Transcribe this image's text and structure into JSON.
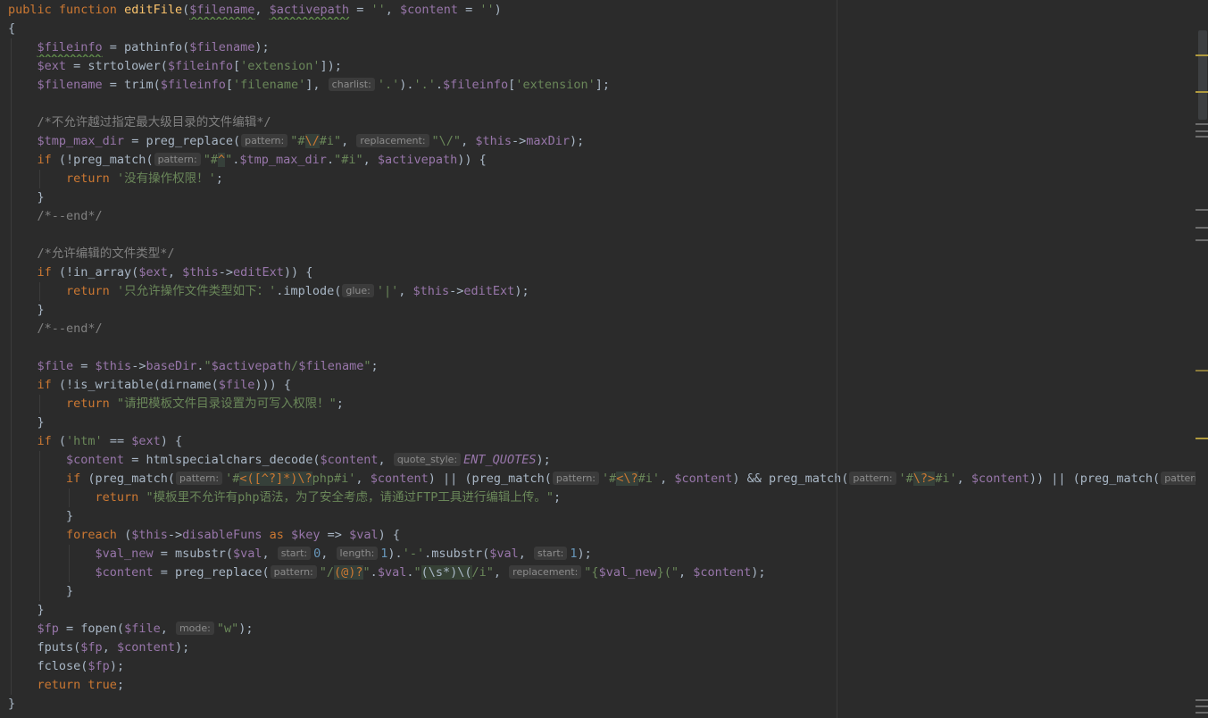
{
  "editor": {
    "language": "php",
    "line_height": 21,
    "char_width": 8.1,
    "lines": [
      {
        "indent": 0,
        "tokens": [
          [
            "kw",
            "public "
          ],
          [
            "kw",
            "function "
          ],
          [
            "fn",
            "editFile"
          ],
          [
            "txt",
            "("
          ],
          [
            "var",
            "$filename"
          ],
          [
            "txt",
            ", "
          ],
          [
            "var",
            "$activepath"
          ],
          [
            "txt",
            " = "
          ],
          [
            "str",
            "''"
          ],
          [
            "txt",
            ", "
          ],
          [
            "var",
            "$content"
          ],
          [
            "txt",
            " = "
          ],
          [
            "str",
            "''"
          ],
          [
            "txt",
            ")"
          ]
        ]
      },
      {
        "indent": 0,
        "tokens": [
          [
            "txt",
            "{"
          ]
        ]
      },
      {
        "indent": 1,
        "tokens": [
          [
            "var",
            "$fileinfo"
          ],
          [
            "txt",
            " = pathinfo("
          ],
          [
            "var",
            "$filename"
          ],
          [
            "txt",
            ");"
          ]
        ]
      },
      {
        "indent": 1,
        "tokens": [
          [
            "var",
            "$ext"
          ],
          [
            "txt",
            " = strtolower("
          ],
          [
            "var",
            "$fileinfo"
          ],
          [
            "txt",
            "["
          ],
          [
            "str",
            "'extension'"
          ],
          [
            "txt",
            "]);"
          ]
        ]
      },
      {
        "indent": 1,
        "tokens": [
          [
            "var",
            "$filename"
          ],
          [
            "txt",
            " = trim("
          ],
          [
            "var",
            "$fileinfo"
          ],
          [
            "txt",
            "["
          ],
          [
            "str",
            "'filename'"
          ],
          [
            "txt",
            "], "
          ],
          [
            "hint",
            "charlist:"
          ],
          [
            "str",
            "'.'"
          ],
          [
            "txt",
            ")."
          ],
          [
            "str",
            "'.'"
          ],
          [
            "txt",
            "."
          ],
          [
            "var",
            "$fileinfo"
          ],
          [
            "txt",
            "["
          ],
          [
            "str",
            "'extension'"
          ],
          [
            "txt",
            "];"
          ]
        ]
      },
      {
        "indent": 0,
        "tokens": []
      },
      {
        "indent": 1,
        "tokens": [
          [
            "cmt",
            "/*不允许越过指定最大级目录的文件编辑*/"
          ]
        ]
      },
      {
        "indent": 1,
        "tokens": [
          [
            "var",
            "$tmp_max_dir"
          ],
          [
            "txt",
            " = preg_replace("
          ],
          [
            "hint",
            "pattern:"
          ],
          [
            "str",
            "\"#"
          ],
          [
            "rx",
            "\\/"
          ],
          [
            "str",
            "#i\""
          ],
          [
            "txt",
            ", "
          ],
          [
            "hint",
            "replacement:"
          ],
          [
            "str",
            "\"\\/\""
          ],
          [
            "txt",
            ", "
          ],
          [
            "var",
            "$this"
          ],
          [
            "txt",
            "->"
          ],
          [
            "prop",
            "maxDir"
          ],
          [
            "txt",
            ");"
          ]
        ]
      },
      {
        "indent": 1,
        "tokens": [
          [
            "kw",
            "if "
          ],
          [
            "txt",
            "(!preg_match("
          ],
          [
            "hint",
            "pattern:"
          ],
          [
            "str",
            "\"#"
          ],
          [
            "rx",
            "^"
          ],
          [
            "str",
            "\""
          ],
          [
            "txt",
            "."
          ],
          [
            "var",
            "$tmp_max_dir"
          ],
          [
            "txt",
            "."
          ],
          [
            "str",
            "\"#i\""
          ],
          [
            "txt",
            ", "
          ],
          [
            "var",
            "$activepath"
          ],
          [
            "txt",
            ")) {"
          ]
        ]
      },
      {
        "indent": 2,
        "tokens": [
          [
            "kw",
            "return "
          ],
          [
            "str",
            "'没有操作权限！'"
          ],
          [
            "txt",
            ";"
          ]
        ]
      },
      {
        "indent": 1,
        "tokens": [
          [
            "txt",
            "}"
          ]
        ]
      },
      {
        "indent": 1,
        "tokens": [
          [
            "cmt",
            "/*--end*/"
          ]
        ]
      },
      {
        "indent": 0,
        "tokens": []
      },
      {
        "indent": 1,
        "tokens": [
          [
            "cmt",
            "/*允许编辑的文件类型*/"
          ]
        ]
      },
      {
        "indent": 1,
        "tokens": [
          [
            "kw",
            "if "
          ],
          [
            "txt",
            "(!in_array("
          ],
          [
            "var",
            "$ext"
          ],
          [
            "txt",
            ", "
          ],
          [
            "var",
            "$this"
          ],
          [
            "txt",
            "->"
          ],
          [
            "prop",
            "editExt"
          ],
          [
            "txt",
            ")) {"
          ]
        ]
      },
      {
        "indent": 2,
        "tokens": [
          [
            "kw",
            "return "
          ],
          [
            "str",
            "'只允许操作文件类型如下：'"
          ],
          [
            "txt",
            ".implode("
          ],
          [
            "hint",
            "glue:"
          ],
          [
            "str",
            "'|'"
          ],
          [
            "txt",
            ", "
          ],
          [
            "var",
            "$this"
          ],
          [
            "txt",
            "->"
          ],
          [
            "prop",
            "editExt"
          ],
          [
            "txt",
            ");"
          ]
        ]
      },
      {
        "indent": 1,
        "tokens": [
          [
            "txt",
            "}"
          ]
        ]
      },
      {
        "indent": 1,
        "tokens": [
          [
            "cmt",
            "/*--end*/"
          ]
        ]
      },
      {
        "indent": 0,
        "tokens": []
      },
      {
        "indent": 1,
        "tokens": [
          [
            "var",
            "$file"
          ],
          [
            "txt",
            " = "
          ],
          [
            "var",
            "$this"
          ],
          [
            "txt",
            "->"
          ],
          [
            "prop",
            "baseDir"
          ],
          [
            "txt",
            "."
          ],
          [
            "str",
            "\""
          ],
          [
            "var",
            "$activepath"
          ],
          [
            "str",
            "/"
          ],
          [
            "var",
            "$filename"
          ],
          [
            "str",
            "\""
          ],
          [
            "txt",
            ";"
          ]
        ]
      },
      {
        "indent": 1,
        "tokens": [
          [
            "kw",
            "if "
          ],
          [
            "txt",
            "(!is_writable(dirname("
          ],
          [
            "var",
            "$file"
          ],
          [
            "txt",
            "))) {"
          ]
        ]
      },
      {
        "indent": 2,
        "tokens": [
          [
            "kw",
            "return "
          ],
          [
            "str",
            "\"请把模板文件目录设置为可写入权限！\""
          ],
          [
            "txt",
            ";"
          ]
        ]
      },
      {
        "indent": 1,
        "tokens": [
          [
            "txt",
            "}"
          ]
        ]
      },
      {
        "indent": 1,
        "tokens": [
          [
            "kw",
            "if "
          ],
          [
            "txt",
            "("
          ],
          [
            "str",
            "'htm'"
          ],
          [
            "txt",
            " == "
          ],
          [
            "var",
            "$ext"
          ],
          [
            "txt",
            ") {"
          ]
        ]
      },
      {
        "indent": 2,
        "tokens": [
          [
            "var",
            "$content"
          ],
          [
            "txt",
            " = htmlspecialchars_decode("
          ],
          [
            "var",
            "$content"
          ],
          [
            "txt",
            ", "
          ],
          [
            "hint",
            "quote_style:"
          ],
          [
            "const",
            "ENT_QUOTES"
          ],
          [
            "txt",
            ");"
          ]
        ]
      },
      {
        "indent": 2,
        "tokens": [
          [
            "kw",
            "if "
          ],
          [
            "txt",
            "(preg_match("
          ],
          [
            "hint",
            "pattern:"
          ],
          [
            "str",
            "'#"
          ],
          [
            "rx",
            "<([^?]*)\\?"
          ],
          [
            "str",
            "php#i'"
          ],
          [
            "txt",
            ", "
          ],
          [
            "var",
            "$content"
          ],
          [
            "txt",
            ") || (preg_match("
          ],
          [
            "hint",
            "pattern:"
          ],
          [
            "str",
            "'#"
          ],
          [
            "rx",
            "<\\?"
          ],
          [
            "str",
            "#i'"
          ],
          [
            "txt",
            ", "
          ],
          [
            "var",
            "$content"
          ],
          [
            "txt",
            ") && preg_match("
          ],
          [
            "hint",
            "pattern:"
          ],
          [
            "str",
            "'#"
          ],
          [
            "rx",
            "\\?>"
          ],
          [
            "str",
            "#i'"
          ],
          [
            "txt",
            ", "
          ],
          [
            "var",
            "$content"
          ],
          [
            "txt",
            ")) || (preg_match("
          ],
          [
            "hint",
            "pattern:"
          ],
          [
            "str",
            "'#"
          ]
        ]
      },
      {
        "indent": 3,
        "tokens": [
          [
            "kw",
            "return "
          ],
          [
            "str",
            "\"模板里不允许有php语法，为了安全考虑，请通过FTP工具进行编辑上传。\""
          ],
          [
            "txt",
            ";"
          ]
        ]
      },
      {
        "indent": 2,
        "tokens": [
          [
            "txt",
            "}"
          ]
        ]
      },
      {
        "indent": 2,
        "tokens": [
          [
            "kw",
            "foreach "
          ],
          [
            "txt",
            "("
          ],
          [
            "var",
            "$this"
          ],
          [
            "txt",
            "->"
          ],
          [
            "prop",
            "disableFuns"
          ],
          [
            "kw",
            " as "
          ],
          [
            "var",
            "$key"
          ],
          [
            "txt",
            " => "
          ],
          [
            "var",
            "$val"
          ],
          [
            "txt",
            ") {"
          ]
        ]
      },
      {
        "indent": 3,
        "tokens": [
          [
            "var",
            "$val_new"
          ],
          [
            "txt",
            " = msubstr("
          ],
          [
            "var",
            "$val"
          ],
          [
            "txt",
            ", "
          ],
          [
            "hint",
            "start:"
          ],
          [
            "num",
            "0"
          ],
          [
            "txt",
            ", "
          ],
          [
            "hint",
            "length:"
          ],
          [
            "num",
            "1"
          ],
          [
            "txt",
            ")."
          ],
          [
            "str",
            "'-'"
          ],
          [
            "txt",
            ".msubstr("
          ],
          [
            "var",
            "$val"
          ],
          [
            "txt",
            ", "
          ],
          [
            "hint",
            "start:"
          ],
          [
            "num",
            "1"
          ],
          [
            "txt",
            ");"
          ]
        ]
      },
      {
        "indent": 3,
        "tokens": [
          [
            "var",
            "$content"
          ],
          [
            "txt",
            " = preg_replace("
          ],
          [
            "hint",
            "pattern:"
          ],
          [
            "str",
            "\"/"
          ],
          [
            "rx",
            "(@)?"
          ],
          [
            "str",
            "\""
          ],
          [
            "txt",
            "."
          ],
          [
            "var",
            "$val"
          ],
          [
            "txt",
            "."
          ],
          [
            "str",
            "\""
          ],
          [
            "rxs",
            "(\\s*)\\("
          ],
          [
            "str",
            "/i\""
          ],
          [
            "txt",
            ", "
          ],
          [
            "hint",
            "replacement:"
          ],
          [
            "str",
            "\"{"
          ],
          [
            "var",
            "$val_new"
          ],
          [
            "str",
            "}(\""
          ],
          [
            "txt",
            ", "
          ],
          [
            "var",
            "$content"
          ],
          [
            "txt",
            ");"
          ]
        ]
      },
      {
        "indent": 2,
        "tokens": [
          [
            "txt",
            "}"
          ]
        ]
      },
      {
        "indent": 1,
        "tokens": [
          [
            "txt",
            "}"
          ]
        ]
      },
      {
        "indent": 1,
        "tokens": [
          [
            "var",
            "$fp"
          ],
          [
            "txt",
            " = fopen("
          ],
          [
            "var",
            "$file"
          ],
          [
            "txt",
            ", "
          ],
          [
            "hint",
            "mode:"
          ],
          [
            "str",
            "\"w\""
          ],
          [
            "txt",
            ");"
          ]
        ]
      },
      {
        "indent": 1,
        "tokens": [
          [
            "txt",
            "fputs("
          ],
          [
            "var",
            "$fp"
          ],
          [
            "txt",
            ", "
          ],
          [
            "var",
            "$content"
          ],
          [
            "txt",
            ");"
          ]
        ]
      },
      {
        "indent": 1,
        "tokens": [
          [
            "txt",
            "fclose("
          ],
          [
            "var",
            "$fp"
          ],
          [
            "txt",
            ");"
          ]
        ]
      },
      {
        "indent": 1,
        "tokens": [
          [
            "kw",
            "return "
          ],
          [
            "kw",
            "true"
          ],
          [
            "txt",
            ";"
          ]
        ]
      },
      {
        "indent": 0,
        "tokens": [
          [
            "txt",
            "}"
          ]
        ]
      }
    ]
  },
  "scrollbar_markers": [
    {
      "color": "#b09a3e"
    },
    {
      "color": "#b09a3e"
    },
    {
      "color": "#6b6b6b"
    },
    {
      "color": "#6b6b6b"
    },
    {
      "color": "#6b6b6b"
    },
    {
      "color": "#6b6b6b"
    },
    {
      "color": "#6b6b6b"
    },
    {
      "color": "#6b6b6b"
    },
    {
      "color": "#8a7a3a"
    },
    {
      "color": "#b09a3e"
    },
    {
      "color": "#6b6b6b"
    },
    {
      "color": "#6b6b6b"
    },
    {
      "color": "#6b6b6b"
    }
  ]
}
